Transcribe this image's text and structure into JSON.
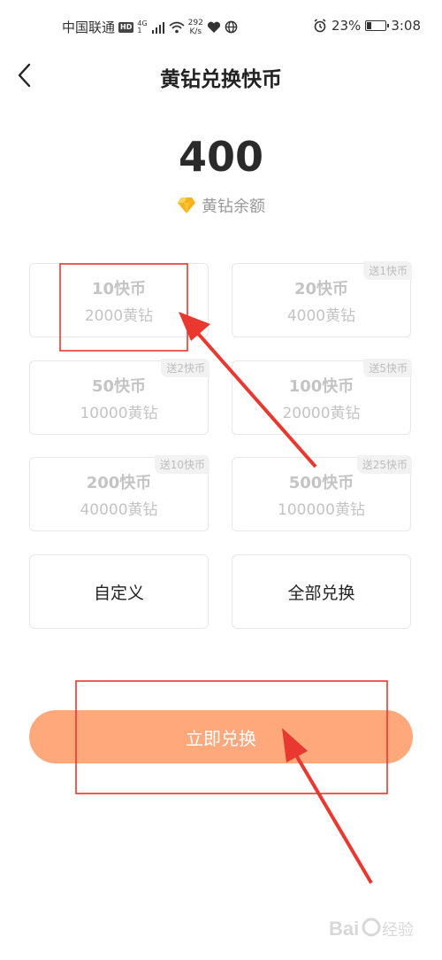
{
  "status_bar": {
    "carrier": "中国联通",
    "hd_badge": "HD",
    "net_top": "4G",
    "net_bottom": "1",
    "speed_value": "292",
    "speed_unit": "K/s",
    "battery_percent": "23%",
    "battery_level": 0.23,
    "time": "3:08"
  },
  "header": {
    "title": "黄钻兑换快币"
  },
  "balance": {
    "value": "400",
    "label": "黄钻余额"
  },
  "options": [
    {
      "coins": "10快币",
      "diamonds": "2000黄钻",
      "bonus": ""
    },
    {
      "coins": "20快币",
      "diamonds": "4000黄钻",
      "bonus": "送1快币"
    },
    {
      "coins": "50快币",
      "diamonds": "10000黄钻",
      "bonus": "送2快币"
    },
    {
      "coins": "100快币",
      "diamonds": "20000黄钻",
      "bonus": "送5快币"
    },
    {
      "coins": "200快币",
      "diamonds": "40000黄钻",
      "bonus": "送10快币"
    },
    {
      "coins": "500快币",
      "diamonds": "100000黄钻",
      "bonus": "送25快币"
    }
  ],
  "custom_label": "自定义",
  "exchange_all_label": "全部兑换",
  "exchange_button_label": "立即兑换",
  "colors": {
    "accent": "#fea87c",
    "annotation_red": "#e8382f",
    "diamond": "#f5b41e"
  }
}
